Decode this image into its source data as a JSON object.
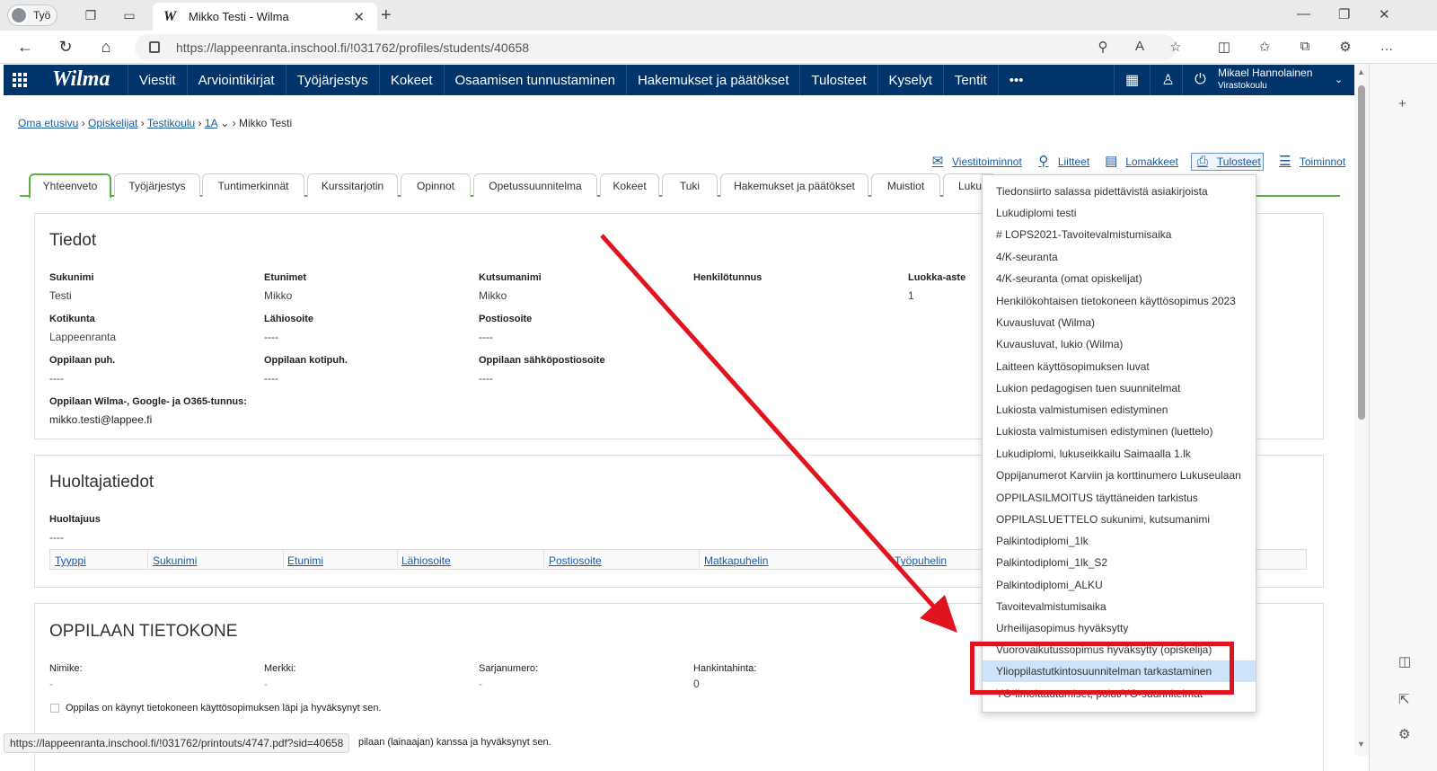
{
  "browser": {
    "profile_label": "Työ",
    "tab_title": "Mikko Testi - Wilma",
    "tab_favicon": "W",
    "url": "https://lappeenranta.inschool.fi/!031762/profiles/students/40658",
    "status_url": "https://lappeenranta.inschool.fi/!031762/printouts/4747.pdf?sid=40658"
  },
  "wilma": {
    "logo": "Wilma",
    "menu": [
      "Viestit",
      "Arviointikirjat",
      "Työjärjestys",
      "Kokeet",
      "Osaamisen tunnustaminen",
      "Hakemukset ja päätökset",
      "Tulosteet",
      "Kyselyt",
      "Tentit",
      "•••"
    ],
    "user_name": "Mikael Hannolainen",
    "user_school": "Virastokoulu"
  },
  "breadcrumb": {
    "items": [
      "Oma etusivu",
      "Opiskelijat",
      "Testikoulu",
      "1A"
    ],
    "current": "Mikko Testi"
  },
  "actions": [
    "Viestitoiminnot",
    "Liitteet",
    "Lomakkeet",
    "Tulosteet",
    "Toiminnot"
  ],
  "tabs": [
    "Yhteenveto",
    "Työjärjestys",
    "Tuntimerkinnät",
    "Kurssitarjotin",
    "Opinnot",
    "Opetussuunnitelma",
    "Kokeet",
    "Tuki",
    "Hakemukset ja päätökset",
    "Muistiot",
    "Luku"
  ],
  "tiedot": {
    "title": "Tiedot",
    "fields": [
      {
        "label": "Sukunimi",
        "value": "Testi"
      },
      {
        "label": "Etunimet",
        "value": "Mikko"
      },
      {
        "label": "Kutsumanimi",
        "value": "Mikko"
      },
      {
        "label": "Henkilötunnus",
        "value": ""
      },
      {
        "label": "Luokka-aste",
        "value": "1"
      },
      {
        "label": "Kotikunta",
        "value": "Lappeenranta"
      },
      {
        "label": "Lähiosoite",
        "value": "----"
      },
      {
        "label": "Postiosoite",
        "value": "----"
      },
      {
        "label": "Oppilaan puh.",
        "value": "----"
      },
      {
        "label": "Oppilaan kotipuh.",
        "value": "----"
      },
      {
        "label": "Oppilaan sähköpostiosoite",
        "value": "----"
      },
      {
        "label": "Oppilaan Wilma-, Google- ja O365-tunnus:",
        "value": "mikko.testi@lappee.fi"
      }
    ]
  },
  "huoltaja": {
    "title": "Huoltajatiedot",
    "label": "Huoltajuus",
    "value": "----",
    "columns": [
      "Tyyppi",
      "Sukunimi",
      "Etunimi",
      "Lähiosoite",
      "Postiosoite",
      "Matkapuhelin",
      "Työpuhelin"
    ]
  },
  "tietokone": {
    "title": "OPPILAAN TIETOKONE",
    "fields": [
      {
        "label": "Nimike:",
        "value": "-"
      },
      {
        "label": "Merkki:",
        "value": "-"
      },
      {
        "label": "Sarjanumero:",
        "value": "-"
      },
      {
        "label": "Hankintahinta:",
        "value": "0"
      }
    ],
    "check1": "Oppilas on käynyt tietokoneen käyttösopimuksen läpi ja hyväksynyt sen.",
    "check2_fragment": "pilaan (lainaajan) kanssa ja hyväksynyt sen."
  },
  "dropdown_items": [
    "Tiedonsiirto salassa pidettävistä asiakirjoista",
    "Lukudiplomi testi",
    "# LOPS2021-Tavoitevalmistumisaika",
    "4/K-seuranta",
    "4/K-seuranta (omat opiskelijat)",
    "Henkilökohtaisen tietokoneen käyttösopimus 2023",
    "Kuvausluvat (Wilma)",
    "Kuvausluvat, lukio (Wilma)",
    "Laitteen käyttösopimuksen luvat",
    "Lukion pedagogisen tuen suunnitelmat",
    "Lukiosta valmistumisen edistyminen",
    "Lukiosta valmistumisen edistyminen (luettelo)",
    "Lukudiplomi, lukuseikkailu Saimaalla 1.lk",
    "Oppijanumerot Karviin ja korttinumero Lukuseulaan",
    "OPPILASILMOITUS täyttäneiden tarkistus",
    "OPPILASLUETTELO sukunimi, kutsumanimi",
    "Palkintodiplomi_1lk",
    "Palkintodiplomi_1lk_S2",
    "Palkintodiplomi_ALKU",
    "Tavoitevalmistumisaika",
    "Urheilijasopimus hyväksytty",
    "Vuorovaikutussopimus hyväksytty (opiskelija)",
    "Ylioppilastutkintosuunnitelman tarkastaminen",
    "YO-ilmoittautumiset, polut/YO-suunnitelmat"
  ],
  "highlighted_item": "Ylioppilastutkintosuunnitelman tarkastaminen",
  "colors": {
    "header": "#00356b",
    "link": "#1a5ca8",
    "tab_accent": "#5cb040",
    "annotation": "#e0141e",
    "highlight": "#cde3fa"
  }
}
